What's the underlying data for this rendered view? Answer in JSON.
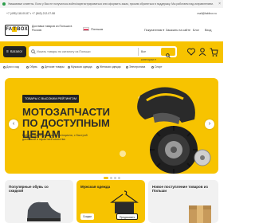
{
  "notice": {
    "text": "Уважаемые клиенты. Если у Вас не получилось войти/зарегистрироваться или оформить заказ, просим обратиться в поддержку. Мы работаем над исправлением.",
    "close": "×"
  },
  "contacts": {
    "phones": "+7 (495) 118-00-87   •   +7 (843) 212-07-58",
    "email": "mail@faktbox.ru"
  },
  "header": {
    "logo_left": "FA",
    "logo_mid": "T",
    "logo_right": "BOX",
    "tagline": "Доставка товаров из Польши в Россию",
    "country": "Польша",
    "nav": [
      "Покупателям ▾",
      "Заказать на сайте",
      "Блог",
      "Вход"
    ]
  },
  "search": {
    "catalog_label": "Каталог",
    "placeholder": "Искать товары по каталогу из Польши",
    "category": "Все категории ▾",
    "accent": "#f7c300"
  },
  "categories": [
    "Дом и сад",
    "Обувь",
    "Детские товары",
    "Мужская одежда",
    "Женская одежда",
    "Электроника",
    "Спорт"
  ],
  "hero": {
    "badge": "ТОВАРЫ С ВЫСОКИМ РЕЙТИНГОМ",
    "title": "МОТОЗАПЧАСТИ ПО ДОСТУПНЫМ ЦЕНАМ",
    "subtitle": "Всё что нужно для вашего мотоцикла, с быстрой доставкой и гарантией качества",
    "prev": "‹",
    "next": "›"
  },
  "cards": [
    {
      "title": "Популярные обувь со скидкой"
    },
    {
      "title": "Мужская одежда",
      "chip": "Скидки",
      "button": "Предсказать"
    },
    {
      "title": "Новое поступление товаров из Польши"
    }
  ]
}
